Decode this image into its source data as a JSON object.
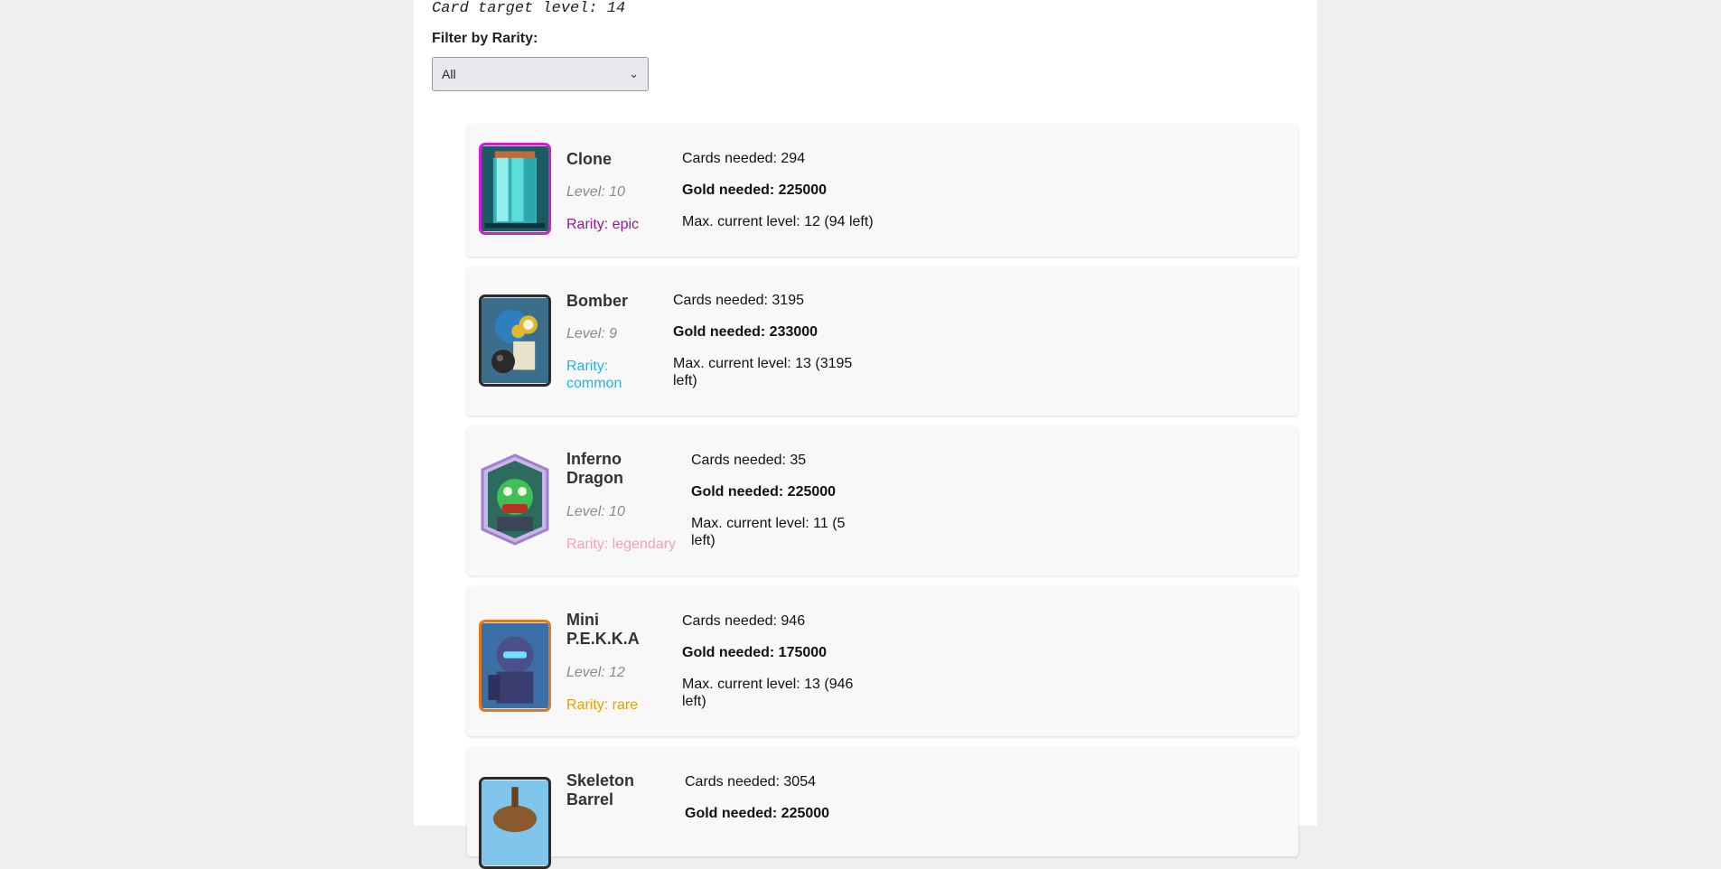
{
  "header": {
    "target_level": "Card target level: 14",
    "filter_label": "Filter by Rarity:",
    "filter_value": "All"
  },
  "colors": {
    "epic": "#8e1b8e",
    "common": "#1fb5e0",
    "legendary": "#f5a3b3",
    "rare": "#e8a000"
  },
  "cards": [
    {
      "name": "Clone",
      "level": "Level: 10",
      "rarity": "Rarity: epic",
      "cards_needed": "Cards needed: 294",
      "gold_needed": "Gold needed: 225000",
      "max_level": "Max. current level: 12 (94 left)",
      "icon": "clone-card-icon"
    },
    {
      "name": "Bomber",
      "level": "Level: 9",
      "rarity": "Rarity: common",
      "cards_needed": "Cards needed: 3195",
      "gold_needed": "Gold needed: 233000",
      "max_level": "Max. current level: 13 (3195 left)",
      "icon": "bomber-card-icon"
    },
    {
      "name": "Inferno Dragon",
      "level": "Level: 10",
      "rarity": "Rarity: legendary",
      "cards_needed": "Cards needed: 35",
      "gold_needed": "Gold needed: 225000",
      "max_level": "Max. current level: 11 (5 left)",
      "icon": "inferno-dragon-card-icon"
    },
    {
      "name": "Mini P.E.K.K.A",
      "level": "Level: 12",
      "rarity": "Rarity: rare",
      "cards_needed": "Cards needed: 946",
      "gold_needed": "Gold needed: 175000",
      "max_level": "Max. current level: 13 (946 left)",
      "icon": "mini-pekka-card-icon"
    },
    {
      "name": "Skeleton Barrel",
      "level": "",
      "rarity": "",
      "cards_needed": "Cards needed: 3054",
      "gold_needed": "Gold needed: 225000",
      "max_level": "",
      "icon": "skeleton-barrel-card-icon"
    }
  ]
}
